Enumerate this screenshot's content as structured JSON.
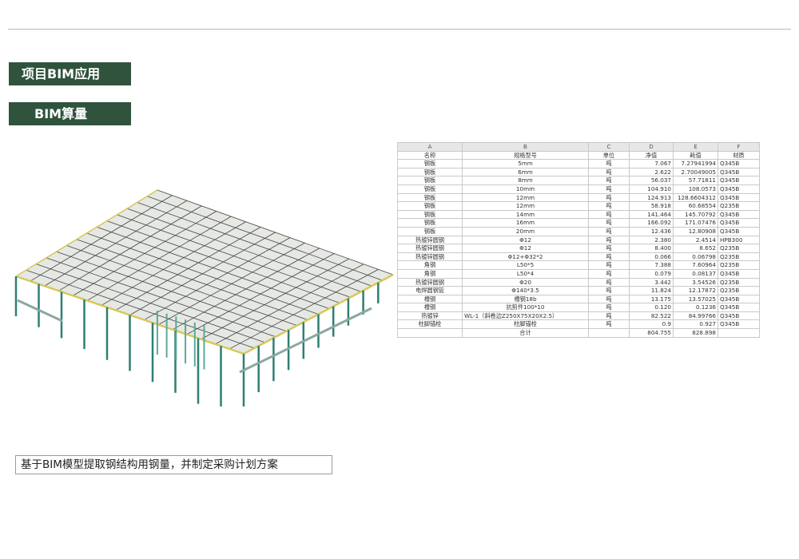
{
  "sections": {
    "project_label": "项目BIM应用",
    "quantity_label": "BIM算量"
  },
  "caption": "基于BIM模型提取钢结构用钢量，并制定采购计划方案",
  "model": {
    "description_icon": "steel-structure-3d-model"
  },
  "spreadsheet": {
    "column_letters": [
      "A",
      "B",
      "C",
      "D",
      "E",
      "F"
    ],
    "headers": [
      "名称",
      "规格型号",
      "单位",
      "净值",
      "耗值",
      "材质"
    ],
    "rows": [
      [
        "钢板",
        "5mm",
        "吨",
        "7.067",
        "7.27941994",
        "Q345B"
      ],
      [
        "钢板",
        "6mm",
        "吨",
        "2.622",
        "2.70049005",
        "Q345B"
      ],
      [
        "钢板",
        "8mm",
        "吨",
        "56.037",
        "57.71811",
        "Q345B"
      ],
      [
        "钢板",
        "10mm",
        "吨",
        "104.910",
        "108.0573",
        "Q345B"
      ],
      [
        "钢板",
        "12mm",
        "吨",
        "124.913",
        "128.6604312",
        "Q345B"
      ],
      [
        "钢板",
        "12mm",
        "吨",
        "58.918",
        "60.68554",
        "Q235B"
      ],
      [
        "钢板",
        "14mm",
        "吨",
        "141.464",
        "145.70792",
        "Q345B"
      ],
      [
        "钢板",
        "16mm",
        "吨",
        "166.092",
        "171.07476",
        "Q345B"
      ],
      [
        "钢板",
        "20mm",
        "吨",
        "12.436",
        "12.80908",
        "Q345B"
      ],
      [
        "热镀锌圆钢",
        "Φ12",
        "吨",
        "2.380",
        "2.4514",
        "HPB300"
      ],
      [
        "热镀锌圆钢",
        "Φ12",
        "吨",
        "8.400",
        "8.652",
        "Q235B"
      ],
      [
        "热镀锌圆钢",
        "Φ12+Φ32*2",
        "吨",
        "0.066",
        "0.06798",
        "Q235B"
      ],
      [
        "角钢",
        "L50*5",
        "吨",
        "7.388",
        "7.60964",
        "Q235B"
      ],
      [
        "角钢",
        "L50*4",
        "吨",
        "0.079",
        "0.08137",
        "Q345B"
      ],
      [
        "热镀锌圆钢",
        "Φ20",
        "吨",
        "3.442",
        "3.54526",
        "Q235B"
      ],
      [
        "电焊圆钢管",
        "Φ140*3.5",
        "吨",
        "11.824",
        "12.17872",
        "Q235B"
      ],
      [
        "槽钢",
        "槽钢18b",
        "吨",
        "13.175",
        "13.57025",
        "Q345B"
      ],
      [
        "槽钢",
        "抗剪件100*10",
        "吨",
        "0.120",
        "0.1236",
        "Q345B"
      ],
      [
        "热镀锌",
        "WL-1（斜卷边Z250X75X20X2.5）",
        "吨",
        "82.522",
        "84.99766",
        "Q345B"
      ],
      [
        "柱脚锚栓",
        "柱脚锚栓",
        "吨",
        "0.9",
        "0.927",
        "Q345B"
      ]
    ],
    "total": [
      "",
      "合计",
      "",
      "804.755",
      "828.898",
      ""
    ]
  }
}
